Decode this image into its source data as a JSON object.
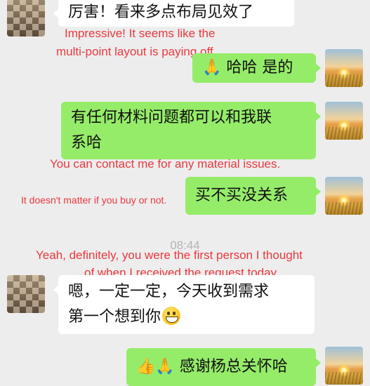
{
  "messages": [
    {
      "text": "厉害！看来多点布局见效了"
    },
    {
      "text": "哈哈 是的",
      "emoji": "🙏"
    },
    {
      "text_line1": "有任何材料问题都可以和我联",
      "text_line2": "系哈"
    },
    {
      "text": "买不买没关系"
    },
    {
      "text_line1": "嗯，一定一定，今天收到需求",
      "text_line2": "第一个想到你"
    },
    {
      "text": "感谢杨总关怀哈",
      "emoji": "👍🙏"
    }
  ],
  "translations": {
    "t1_line1": "Impressive! It seems like the",
    "t1_line2": "multi-point layout is paying off.",
    "t3": "You can contact me for any material issues.",
    "t4": "It doesn't matter if you buy or not.",
    "t5_line1": "Yeah, definitely, you were the first person I thought",
    "t5_line2": "of when I received the request today."
  },
  "timestamp": "08:44",
  "colors": {
    "green_bubble": "#95ec69",
    "white_bubble": "#ffffff",
    "translation": "#e8393f",
    "background": "#ededed"
  }
}
